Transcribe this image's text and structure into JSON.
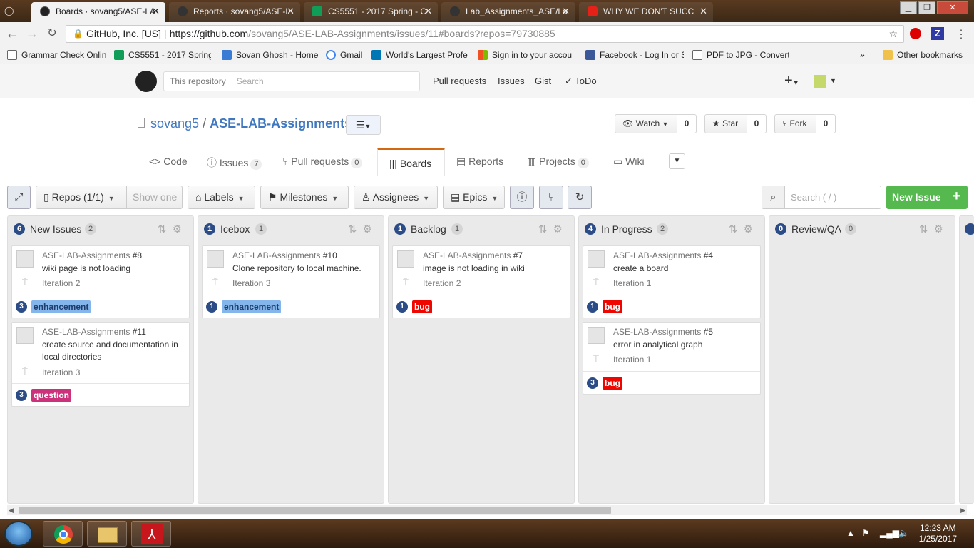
{
  "browser": {
    "tabs": [
      {
        "title": "Boards · sovang5/ASE-LA",
        "active": true,
        "icon": "github-icon"
      },
      {
        "title": "Reports · sovang5/ASE-L",
        "active": false,
        "icon": "github-icon"
      },
      {
        "title": "CS5551 - 2017 Spring - C",
        "active": false,
        "icon": "sheets-icon"
      },
      {
        "title": "Lab_Assignments_ASE/La",
        "active": false,
        "icon": "github-icon"
      },
      {
        "title": "WHY WE DON'T SUCC",
        "active": false,
        "icon": "youtube-icon"
      }
    ],
    "address": {
      "site_name": "GitHub, Inc. [US]",
      "url_host": "https://github.com",
      "url_path": "/sovang5/ASE-LAB-Assignments/issues/11#boards?repos=79730885"
    },
    "bookmarks": [
      "Grammar Check Onlin",
      "CS5551 - 2017 Spring",
      "Sovan Ghosh - Home",
      "Gmail",
      "World's Largest Profe",
      "Sign in to your accou",
      "Facebook - Log In or S",
      "PDF to JPG - Convert"
    ],
    "other_bookmarks": "Other bookmarks",
    "overflow": "»"
  },
  "github": {
    "search_scope": "This repository",
    "search_placeholder": "Search",
    "nav": [
      "Pull requests",
      "Issues",
      "Gist",
      "ToDo"
    ],
    "owner": "sovang5",
    "slash": "/",
    "repo": "ASE-LAB-Assignments",
    "watch": {
      "label": "Watch",
      "count": "0"
    },
    "star": {
      "label": "Star",
      "count": "0"
    },
    "fork": {
      "label": "Fork",
      "count": "0"
    },
    "tabs": {
      "code": "Code",
      "issues": "Issues",
      "issues_count": "7",
      "pulls": "Pull requests",
      "pulls_count": "0",
      "boards": "Boards",
      "reports": "Reports",
      "projects": "Projects",
      "projects_count": "0",
      "wiki": "Wiki"
    }
  },
  "zenhub": {
    "repos": "Repos (1/1)",
    "show_one": "Show one",
    "labels": "Labels",
    "milestones": "Milestones",
    "assignees": "Assignees",
    "epics": "Epics",
    "search_placeholder": "Search ( / )",
    "new_issue": "New Issue"
  },
  "pipelines": [
    {
      "name": "New Issues",
      "points": "6",
      "count": "2",
      "cards": [
        {
          "repo": "ASE-LAB-Assignments",
          "number": "#8",
          "title": "wiki page is not loading",
          "iteration": "Iteration 2",
          "estimate": "3",
          "label": "enhancement",
          "label_color": "#84b6eb",
          "label_text": "#1c3d6e"
        },
        {
          "repo": "ASE-LAB-Assignments",
          "number": "#11",
          "title": "create source and documentation in local directories",
          "iteration": "Iteration 3",
          "estimate": "3",
          "label": "question",
          "label_color": "#cc317c",
          "label_text": "#ffffff"
        }
      ]
    },
    {
      "name": "Icebox",
      "points": "1",
      "count": "1",
      "cards": [
        {
          "repo": "ASE-LAB-Assignments",
          "number": "#10",
          "title": "Clone repository to local machine.",
          "iteration": "Iteration 3",
          "estimate": "1",
          "label": "enhancement",
          "label_color": "#84b6eb",
          "label_text": "#1c3d6e"
        }
      ]
    },
    {
      "name": "Backlog",
      "points": "1",
      "count": "1",
      "cards": [
        {
          "repo": "ASE-LAB-Assignments",
          "number": "#7",
          "title": "image is not loading in wiki",
          "iteration": "Iteration 2",
          "estimate": "1",
          "label": "bug",
          "label_color": "#ee0701",
          "label_text": "#ffffff"
        }
      ]
    },
    {
      "name": "In Progress",
      "points": "4",
      "count": "2",
      "cards": [
        {
          "repo": "ASE-LAB-Assignments",
          "number": "#4",
          "title": "create a board",
          "iteration": "Iteration 1",
          "estimate": "1",
          "label": "bug",
          "label_color": "#ee0701",
          "label_text": "#ffffff"
        },
        {
          "repo": "ASE-LAB-Assignments",
          "number": "#5",
          "title": "error in analytical graph",
          "iteration": "Iteration 1",
          "estimate": "3",
          "label": "bug",
          "label_color": "#ee0701",
          "label_text": "#ffffff"
        }
      ]
    },
    {
      "name": "Review/QA",
      "points": "0",
      "count": "0",
      "cards": []
    }
  ],
  "taskbar": {
    "time": "12:23 AM",
    "date": "1/25/2017"
  }
}
